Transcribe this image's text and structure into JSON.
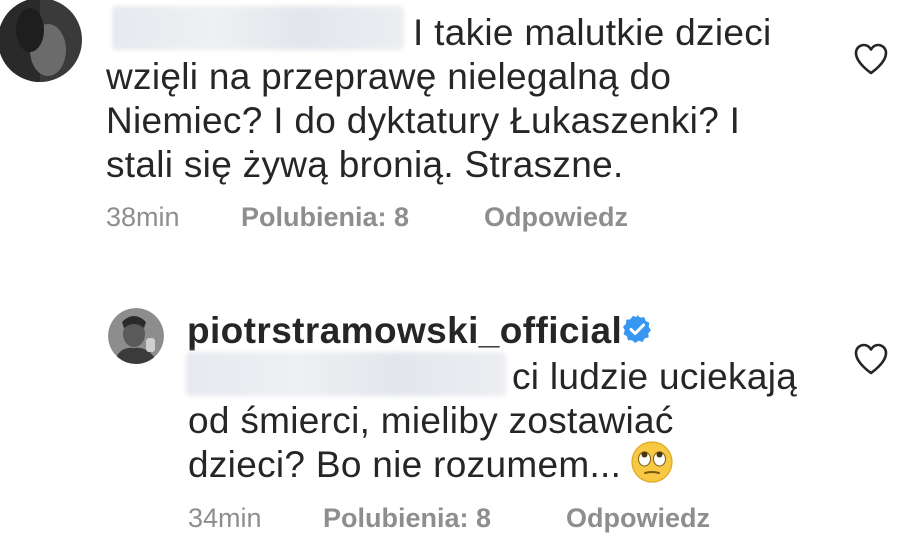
{
  "comments": [
    {
      "text_lines": [
        "I takie malutkie dzieci",
        "wzięli na przeprawę nielegalną do",
        "Niemiec? I do dyktatury Łukaszenki? I",
        "stali się żywą bronią. Straszne."
      ],
      "time": "38min",
      "likes_label": "Polubienia: 8",
      "reply_label": "Odpowiedz",
      "like_icon": "heart-outline-icon"
    },
    {
      "username": "piotrstramowski_official",
      "verified_icon": "verified-badge-icon",
      "text_lines": [
        "ci ludzie uciekają",
        "od śmierci, mieliby zostawiać",
        "dzieci? Bo nie rozumem..."
      ],
      "emoji_icon": "eye-roll-emoji-icon",
      "time": "34min",
      "likes_label": "Polubienia: 8",
      "reply_label": "Odpowiedz",
      "like_icon": "heart-outline-icon"
    }
  ],
  "colors": {
    "text": "#262626",
    "meta": "#8e8e8e",
    "verified": "#3897f0"
  }
}
